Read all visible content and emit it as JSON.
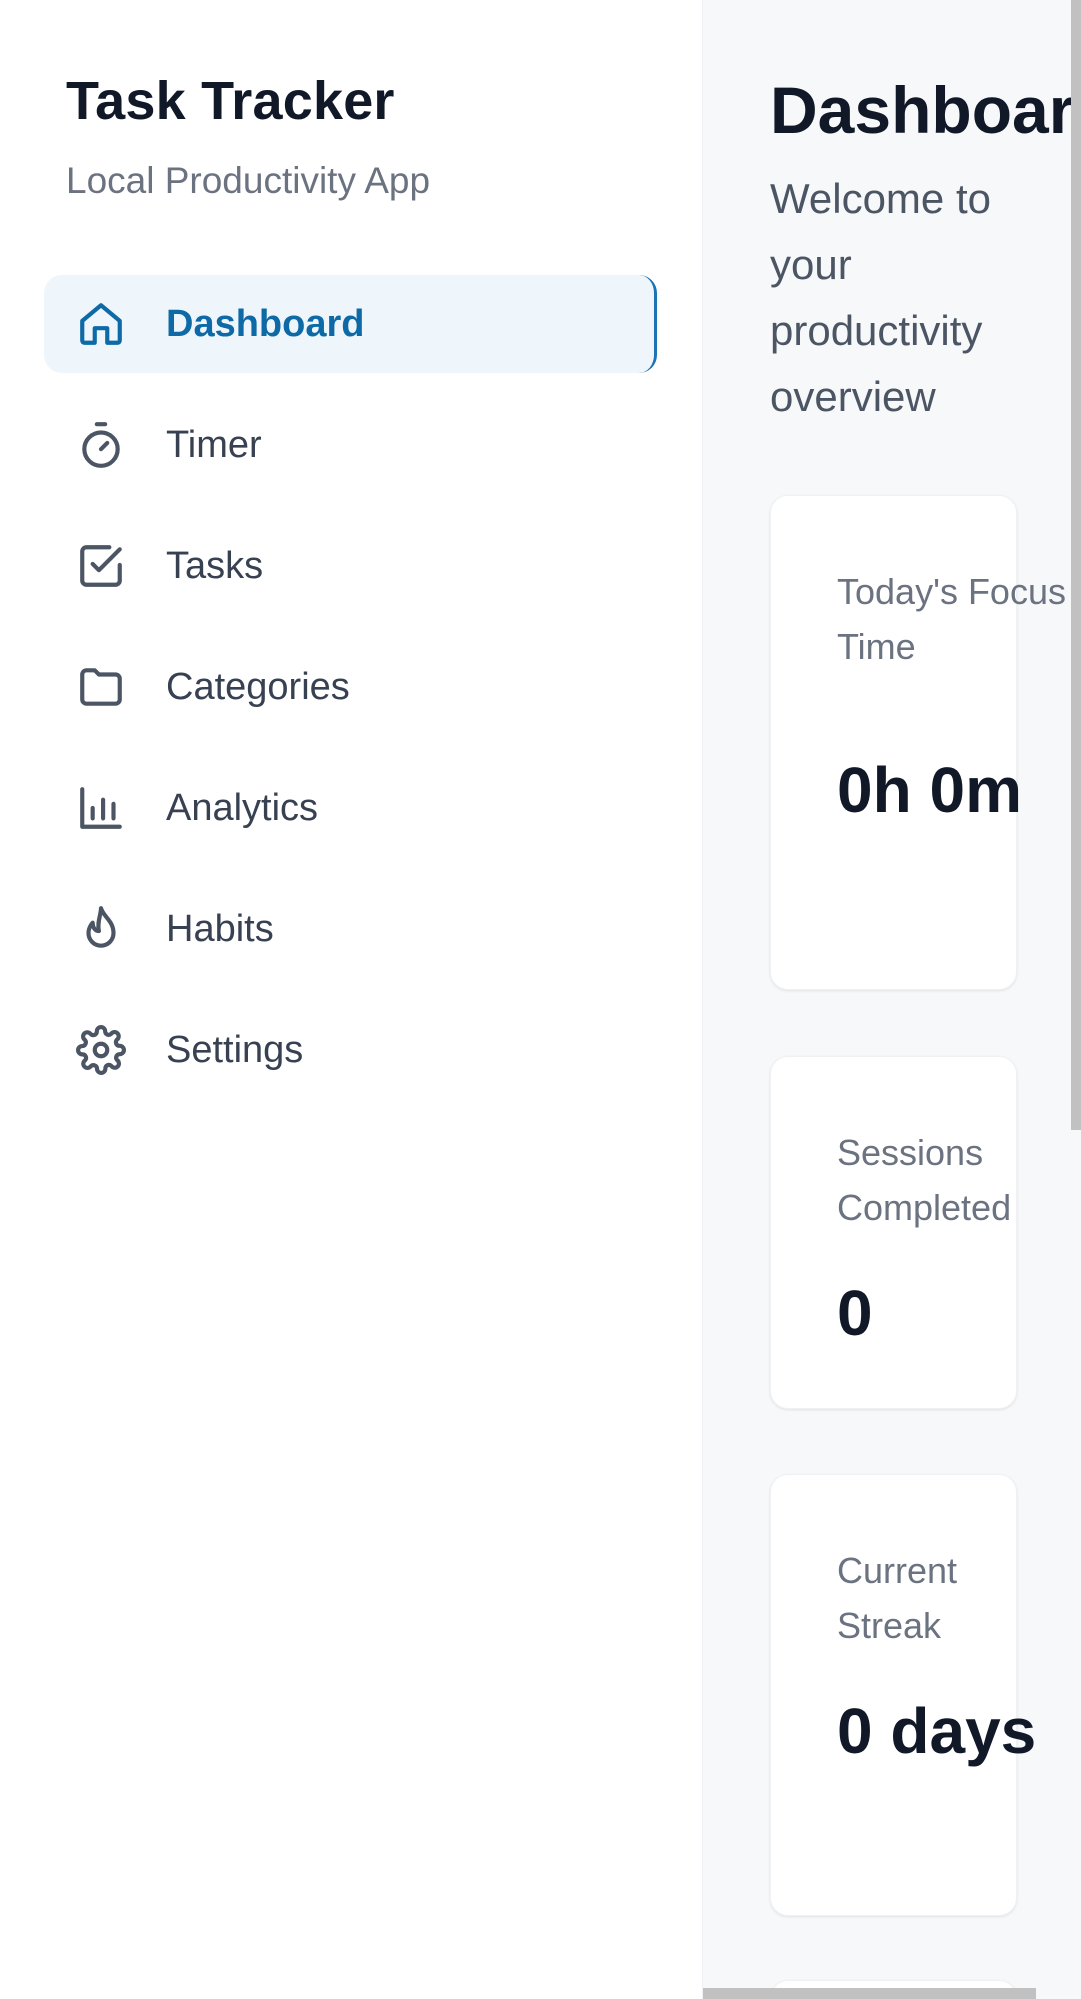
{
  "sidebar": {
    "title": "Task Tracker",
    "subtitle": "Local Productivity App",
    "items": [
      {
        "label": "Dashboard",
        "icon": "home-icon",
        "active": true
      },
      {
        "label": "Timer",
        "icon": "stopwatch-icon",
        "active": false
      },
      {
        "label": "Tasks",
        "icon": "checkbox-icon",
        "active": false
      },
      {
        "label": "Categories",
        "icon": "folder-icon",
        "active": false
      },
      {
        "label": "Analytics",
        "icon": "bar-chart-icon",
        "active": false
      },
      {
        "label": "Habits",
        "icon": "flame-icon",
        "active": false
      },
      {
        "label": "Settings",
        "icon": "gear-icon",
        "active": false
      }
    ]
  },
  "main": {
    "title": "Dashboard",
    "subtitle": "Welcome to your productivity overview",
    "cards": [
      {
        "label": "Today's Focus Time",
        "value": "0h 0m"
      },
      {
        "label": "Sessions Completed",
        "value": "0"
      },
      {
        "label": "Current Streak",
        "value": "0 days"
      }
    ]
  },
  "colors": {
    "accent": "#0e6aa6",
    "active_bg": "#eef6fc",
    "text_primary": "#111827",
    "text_muted": "#6b7280"
  }
}
